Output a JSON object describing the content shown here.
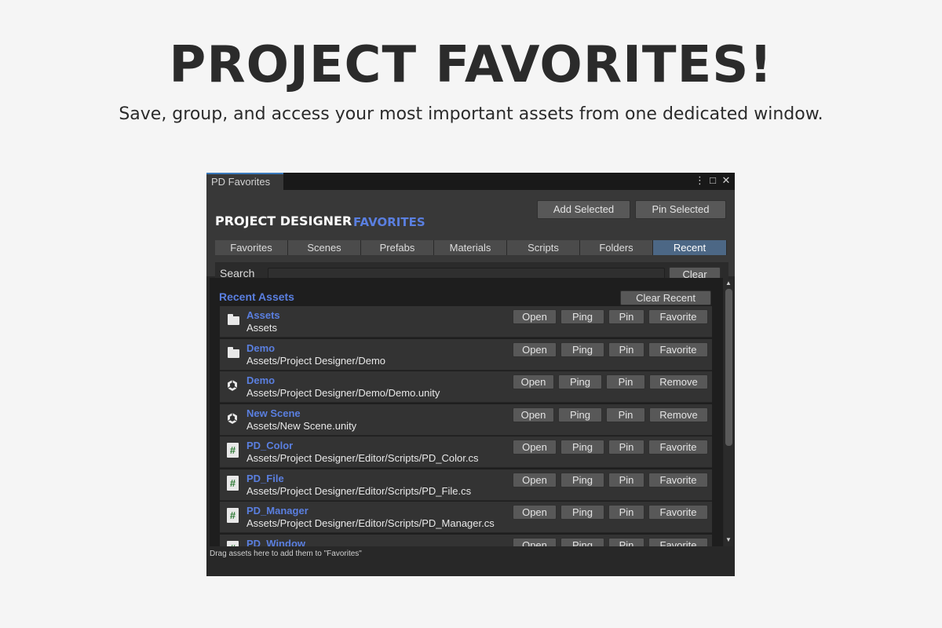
{
  "hero": {
    "title": "PROJECT FAVORITES!",
    "subtitle": "Save, group, and access your most important assets from one dedicated window."
  },
  "window": {
    "tab_title": "PD Favorites",
    "controls": {
      "menu": "⋮",
      "maximize": "□",
      "close": "✕"
    }
  },
  "header": {
    "brand": "PROJECT DESIGNER",
    "brand_accent": "FAVORITES",
    "add_selected": "Add Selected",
    "pin_selected": "Pin Selected"
  },
  "tabs": [
    {
      "label": "Favorites",
      "active": false
    },
    {
      "label": "Scenes",
      "active": false
    },
    {
      "label": "Prefabs",
      "active": false
    },
    {
      "label": "Materials",
      "active": false
    },
    {
      "label": "Scripts",
      "active": false
    },
    {
      "label": "Folders",
      "active": false
    },
    {
      "label": "Recent",
      "active": true
    }
  ],
  "search": {
    "label": "Search",
    "value": "",
    "clear": "Clear"
  },
  "list": {
    "section_title": "Recent Assets",
    "clear_recent": "Clear Recent",
    "rows": [
      {
        "icon": "folder-icon",
        "name": "Assets",
        "path": "Assets",
        "buttons": [
          "Open",
          "Ping",
          "Pin",
          "Favorite"
        ]
      },
      {
        "icon": "folder-icon",
        "name": "Demo",
        "path": "Assets/Project Designer/Demo",
        "buttons": [
          "Open",
          "Ping",
          "Pin",
          "Favorite"
        ]
      },
      {
        "icon": "unity-scene-icon",
        "name": "Demo",
        "path": "Assets/Project Designer/Demo/Demo.unity",
        "buttons": [
          "Open",
          "Ping",
          "Pin",
          "Remove"
        ]
      },
      {
        "icon": "unity-scene-icon",
        "name": "New Scene",
        "path": "Assets/New Scene.unity",
        "buttons": [
          "Open",
          "Ping",
          "Pin",
          "Remove"
        ]
      },
      {
        "icon": "csharp-script-icon",
        "name": "PD_Color",
        "path": "Assets/Project Designer/Editor/Scripts/PD_Color.cs",
        "buttons": [
          "Open",
          "Ping",
          "Pin",
          "Favorite"
        ]
      },
      {
        "icon": "csharp-script-icon",
        "name": "PD_File",
        "path": "Assets/Project Designer/Editor/Scripts/PD_File.cs",
        "buttons": [
          "Open",
          "Ping",
          "Pin",
          "Favorite"
        ]
      },
      {
        "icon": "csharp-script-icon",
        "name": "PD_Manager",
        "path": "Assets/Project Designer/Editor/Scripts/PD_Manager.cs",
        "buttons": [
          "Open",
          "Ping",
          "Pin",
          "Favorite"
        ]
      },
      {
        "icon": "csharp-script-icon",
        "name": "PD_Window",
        "path": "",
        "buttons": [
          "Open",
          "Ping",
          "Pin",
          "Favorite"
        ]
      }
    ]
  },
  "footer": {
    "text": "Drag assets here to add them to \"Favorites\""
  },
  "colors": {
    "accent_blue": "#5a7fe0",
    "active_tab": "#4c6785",
    "panel": "#383838"
  }
}
